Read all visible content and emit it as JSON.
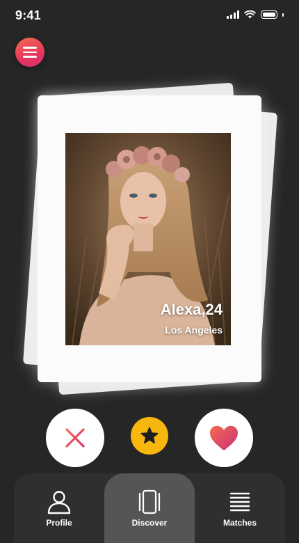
{
  "status_bar": {
    "time": "9:41"
  },
  "menu": {
    "icon": "hamburger-menu-icon"
  },
  "profile_card": {
    "name": "Alexa,24",
    "location": "Los Angeles"
  },
  "actions": {
    "dislike_icon": "close-x-icon",
    "superlike_icon": "star-icon",
    "like_icon": "heart-icon"
  },
  "nav": {
    "items": [
      {
        "label": "Profile",
        "icon": "person-icon",
        "active": false
      },
      {
        "label": "Discover",
        "icon": "cards-icon",
        "active": true
      },
      {
        "label": "Matches",
        "icon": "list-icon",
        "active": false
      }
    ]
  },
  "colors": {
    "background": "#262626",
    "accent_gradient_start": "#f36b4f",
    "accent_gradient_end": "#d4306f",
    "star": "#f8b70f",
    "nav_background": "#2f2f2f",
    "nav_active": "#555555"
  }
}
